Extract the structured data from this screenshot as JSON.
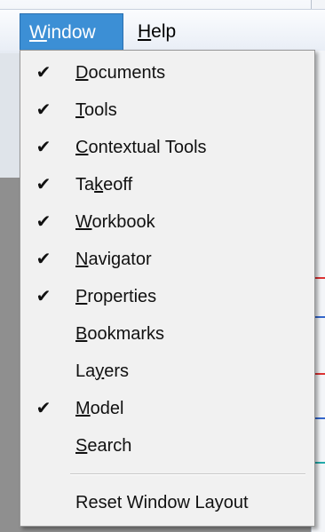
{
  "menubar": {
    "window": {
      "label": "Window",
      "mnemonic_index": 0
    },
    "help": {
      "label": "Help",
      "mnemonic_index": 0
    }
  },
  "window_menu": {
    "items": [
      {
        "label": "Documents",
        "mnemonic_index": 0,
        "checked": true
      },
      {
        "label": "Tools",
        "mnemonic_index": 0,
        "checked": true
      },
      {
        "label": "Contextual Tools",
        "mnemonic_index": 0,
        "checked": true
      },
      {
        "label": "Takeoff",
        "mnemonic_index": 2,
        "checked": true
      },
      {
        "label": "Workbook",
        "mnemonic_index": 0,
        "checked": true
      },
      {
        "label": "Navigator",
        "mnemonic_index": 0,
        "checked": true
      },
      {
        "label": "Properties",
        "mnemonic_index": 0,
        "checked": true
      },
      {
        "label": "Bookmarks",
        "mnemonic_index": 0,
        "checked": false
      },
      {
        "label": "Layers",
        "mnemonic_index": 2,
        "checked": false
      },
      {
        "label": "Model",
        "mnemonic_index": 0,
        "checked": true
      },
      {
        "label": "Search",
        "mnemonic_index": 0,
        "checked": false
      }
    ],
    "footer_item": {
      "label": "Reset Window Layout",
      "checked": false
    }
  },
  "check_glyph": "✔"
}
